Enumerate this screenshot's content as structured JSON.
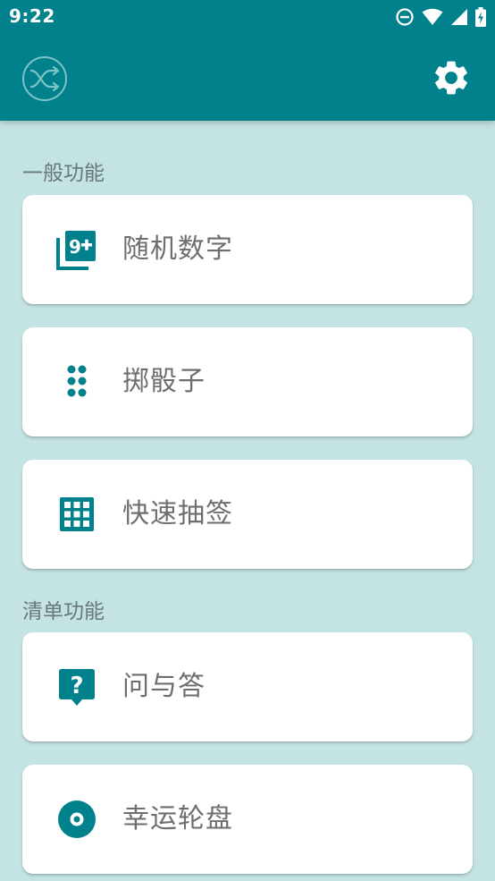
{
  "status_bar": {
    "time": "9:22",
    "icons": [
      "do-not-disturb-icon",
      "wifi-icon",
      "signal-icon",
      "battery-charging-icon"
    ]
  },
  "app_bar": {
    "logo_icon": "shuffle-icon",
    "settings_icon": "gear-icon"
  },
  "sections": [
    {
      "title": "一般功能",
      "items": [
        {
          "label": "随机数字",
          "icon": "numbers-9plus-icon"
        },
        {
          "label": "掷骰子",
          "icon": "dice-dots-icon"
        },
        {
          "label": "快速抽签",
          "icon": "grid-icon"
        }
      ]
    },
    {
      "title": "清单功能",
      "items": [
        {
          "label": "问与答",
          "icon": "question-bubble-icon"
        },
        {
          "label": "幸运轮盘",
          "icon": "disc-icon"
        }
      ]
    }
  ],
  "colors": {
    "primary": "#00818b",
    "background": "#c4e4e3",
    "card": "#ffffff",
    "label_text": "#6e6e6e",
    "section_text": "#6b7879"
  }
}
